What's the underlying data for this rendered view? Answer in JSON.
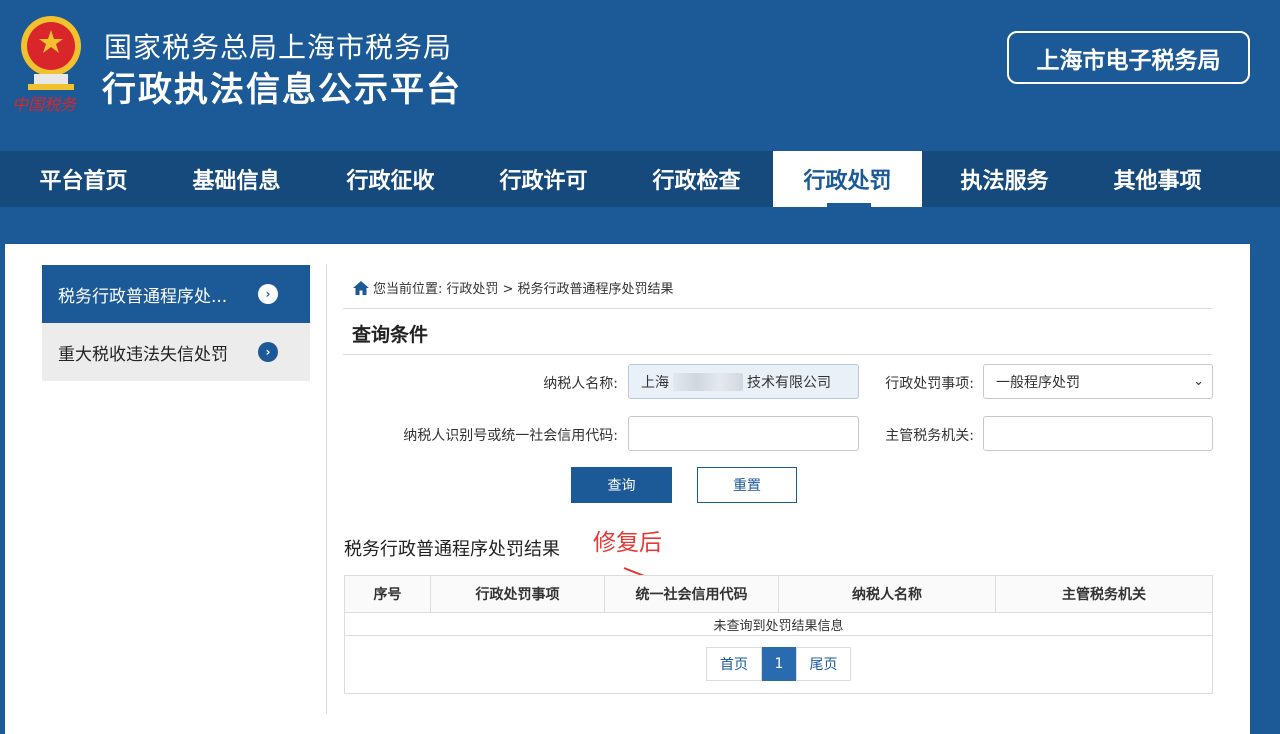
{
  "header": {
    "title_line1": "国家税务总局上海市税务局",
    "title_line2": "行政执法信息公示平台",
    "emblem_caption": "中国税务",
    "etax_button": "上海市电子税务局"
  },
  "nav": {
    "items": [
      {
        "label": "平台首页"
      },
      {
        "label": "基础信息"
      },
      {
        "label": "行政征收"
      },
      {
        "label": "行政许可"
      },
      {
        "label": "行政检查"
      },
      {
        "label": "行政处罚"
      },
      {
        "label": "执法服务"
      },
      {
        "label": "其他事项"
      }
    ],
    "active": "行政处罚"
  },
  "sidebar": {
    "items": [
      {
        "label": "税务行政普通程序处..."
      },
      {
        "label": "重大税收违法失信处罚"
      }
    ]
  },
  "breadcrumb": {
    "prefix": "您当前位置:",
    "path": "行政处罚 > 税务行政普通程序处罚结果"
  },
  "query": {
    "section_title": "查询条件",
    "taxpayer_name_label": "纳税人名称:",
    "taxpayer_name_value_start": "上海",
    "taxpayer_name_value_end": "技术有限公司",
    "penalty_item_label": "行政处罚事项:",
    "penalty_item_value": "一般程序处罚",
    "taxpayer_id_label": "纳税人识别号或统一社会信用代码:",
    "taxpayer_id_value": "",
    "tax_authority_label": "主管税务机关:",
    "tax_authority_value": "",
    "query_button": "查询",
    "reset_button": "重置"
  },
  "results": {
    "title": "税务行政普通程序处罚结果",
    "annotation": "修复后",
    "columns": [
      "序号",
      "行政处罚事项",
      "统一社会信用代码",
      "纳税人名称",
      "主管税务机关"
    ],
    "empty_message": "未查询到处罚结果信息",
    "pager": {
      "first": "首页",
      "current": "1",
      "last": "尾页"
    }
  },
  "colors": {
    "brand_blue": "#1b5a97",
    "nav_bg": "#164a7c",
    "annotation_red": "#e53935"
  }
}
